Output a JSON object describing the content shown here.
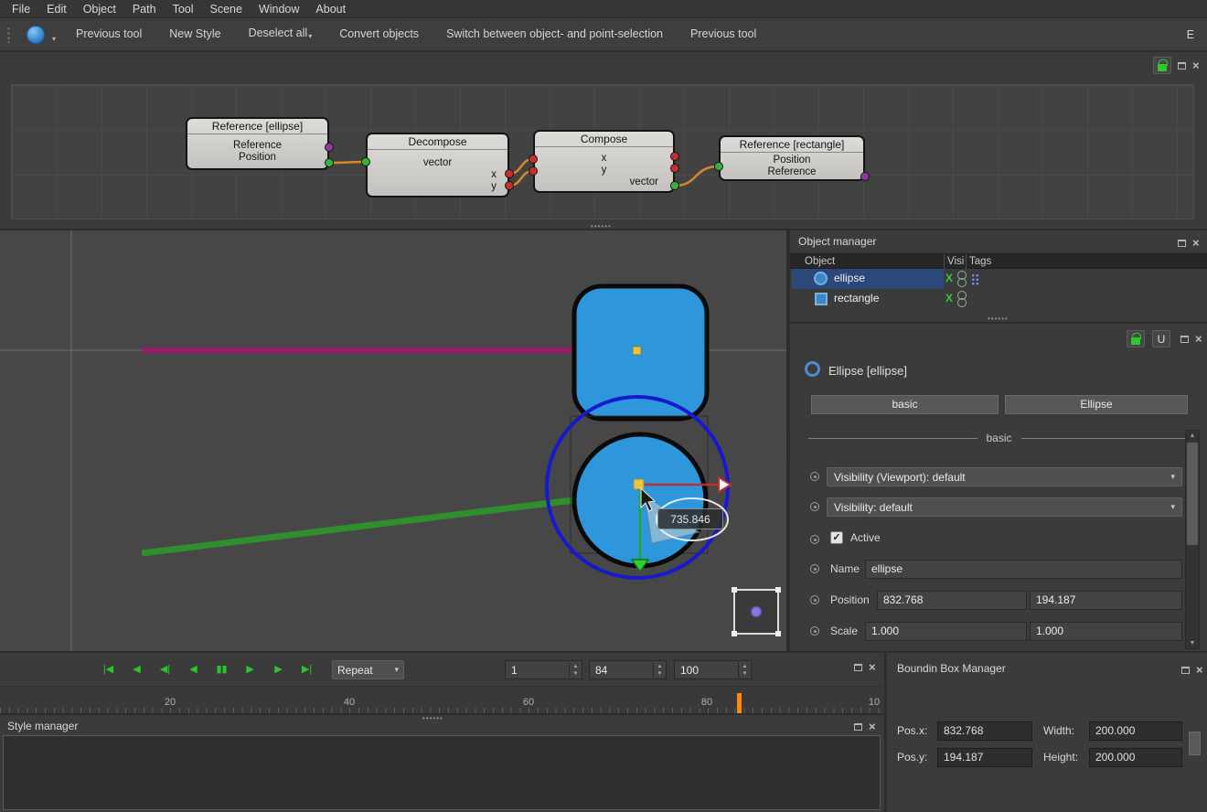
{
  "menu": {
    "items": [
      "File",
      "Edit",
      "Object",
      "Path",
      "Tool",
      "Scene",
      "Window",
      "About"
    ]
  },
  "toolbar": {
    "items": [
      "Previous tool",
      "New Style",
      "Deselect all",
      "Convert objects",
      "Switch between object- and point-selection",
      "Previous tool"
    ],
    "overflow_label": "E"
  },
  "node_editor": {
    "nodes": [
      {
        "title": "Reference [ellipse]",
        "rows": [
          "Reference",
          "Position"
        ]
      },
      {
        "title": "Decompose",
        "rows": [
          "vector",
          "x",
          "y"
        ]
      },
      {
        "title": "Compose",
        "rows": [
          "x",
          "y",
          "vector"
        ]
      },
      {
        "title": "Reference [rectangle]",
        "rows": [
          "Position",
          "Reference"
        ]
      }
    ]
  },
  "canvas": {
    "tooltip": "735.846"
  },
  "object_manager": {
    "title": "Object manager",
    "columns": [
      "Object",
      "Visi",
      "Tags"
    ],
    "rows": [
      {
        "name": "ellipse"
      },
      {
        "name": "rectangle"
      }
    ]
  },
  "properties": {
    "u_button": "U",
    "title": "Ellipse [ellipse]",
    "tabs": [
      "basic",
      "Ellipse"
    ],
    "section": "basic",
    "rows": {
      "visibility_viewport": "Visibility (Viewport): default",
      "visibility": "Visibility: default",
      "active": "Active",
      "name_label": "Name",
      "name_value": "ellipse",
      "position_label": "Position",
      "position_x": "832.768",
      "position_y": "194.187",
      "scale_label": "Scale",
      "scale_x": "1.000",
      "scale_y": "1.000"
    }
  },
  "timeline": {
    "buttons": [
      {
        "name": "skip-start",
        "glyph": "|◀"
      },
      {
        "name": "prev-keyframe",
        "glyph": "◀"
      },
      {
        "name": "prev-frame",
        "glyph": "◀|"
      },
      {
        "name": "play-backward",
        "glyph": "◀"
      },
      {
        "name": "pause",
        "glyph": "▮▮"
      },
      {
        "name": "play",
        "glyph": "▶"
      },
      {
        "name": "play-selection",
        "glyph": "▶"
      },
      {
        "name": "skip-end",
        "glyph": "▶|"
      }
    ],
    "repeat": "Repeat",
    "start": "1",
    "current": "84",
    "end": "100",
    "ruler_ticks": [
      "20",
      "40",
      "60",
      "80",
      "10"
    ]
  },
  "style_manager": {
    "title": "Style manager"
  },
  "bbox_manager": {
    "title": "Boundin Box Manager",
    "posx_label": "Pos.x:",
    "posx_value": "832.768",
    "width_label": "Width:",
    "width_value": "200.000",
    "posy_label": "Pos.y:",
    "posy_value": "194.187",
    "height_label": "Height:",
    "height_value": "200.000"
  },
  "icons": {
    "visible": "X",
    "close": "×",
    "dropdown_arrow": "▾",
    "spin_up": "▲",
    "spin_down": "▼",
    "check": "✓"
  },
  "colors": {
    "shape_blue": "#2e96db",
    "selection_blue": "#1818cf",
    "magenta_arrow": "#8e2069",
    "green_arrow": "#2f8f2f",
    "wire_orange": "#d6882e",
    "playhead_orange": "#fe8a0b",
    "active_green": "#2ec82e"
  }
}
